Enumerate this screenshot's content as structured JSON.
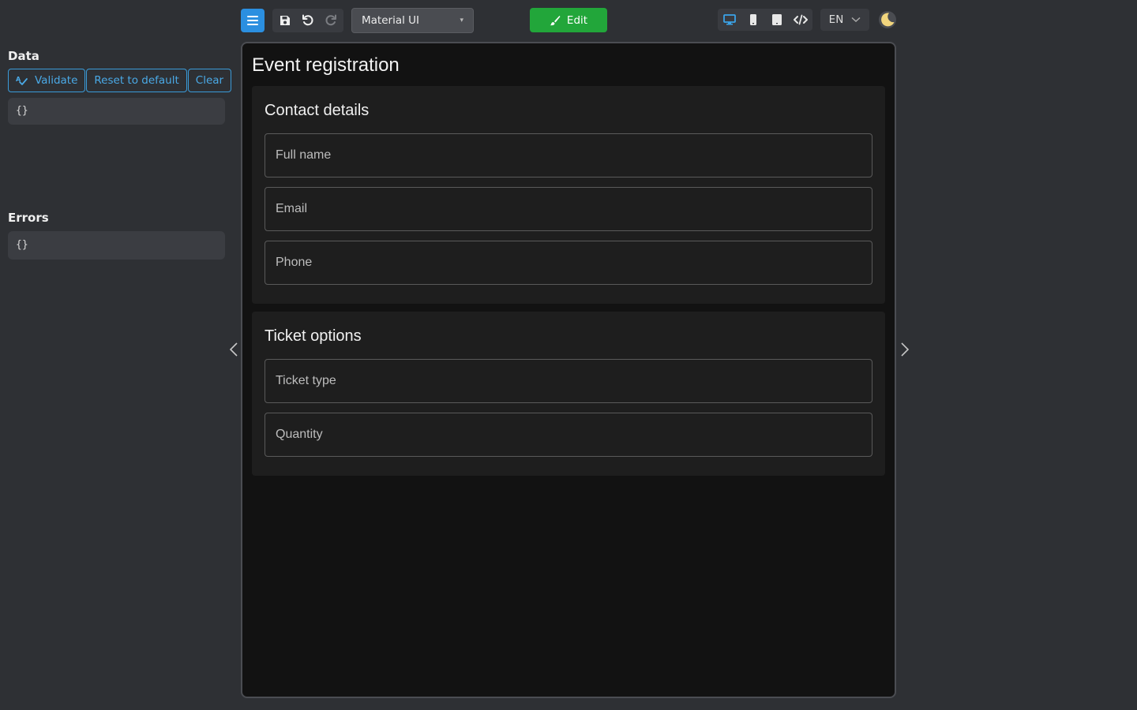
{
  "left_panel": {
    "data_heading": "Data",
    "buttons": {
      "validate": "Validate",
      "reset": "Reset to default",
      "clear": "Clear"
    },
    "data_value": "{}",
    "errors_heading": "Errors",
    "errors_value": "{}"
  },
  "toolbar": {
    "theme_selected": "Material UI",
    "edit_label": "Edit",
    "language": "EN"
  },
  "form": {
    "title": "Event registration",
    "sections": [
      {
        "title": "Contact details",
        "fields": [
          "Full name",
          "Email",
          "Phone"
        ]
      },
      {
        "title": "Ticket options",
        "fields": [
          "Ticket type",
          "Quantity"
        ]
      }
    ]
  },
  "colors": {
    "accent": "#2b8fe0",
    "edit_green": "#22a63a",
    "outline_blue": "#4aa9e6",
    "background": "#2e3034",
    "preview_bg": "#121212"
  },
  "icons": [
    "hamburger-menu-icon",
    "save-icon",
    "undo-icon",
    "redo-icon",
    "brush-icon",
    "desktop-icon",
    "mobile-icon",
    "tablet-icon",
    "code-icon",
    "chevron-down-icon",
    "moon-icon",
    "chevron-left-icon",
    "chevron-right-icon",
    "spellcheck-icon"
  ]
}
